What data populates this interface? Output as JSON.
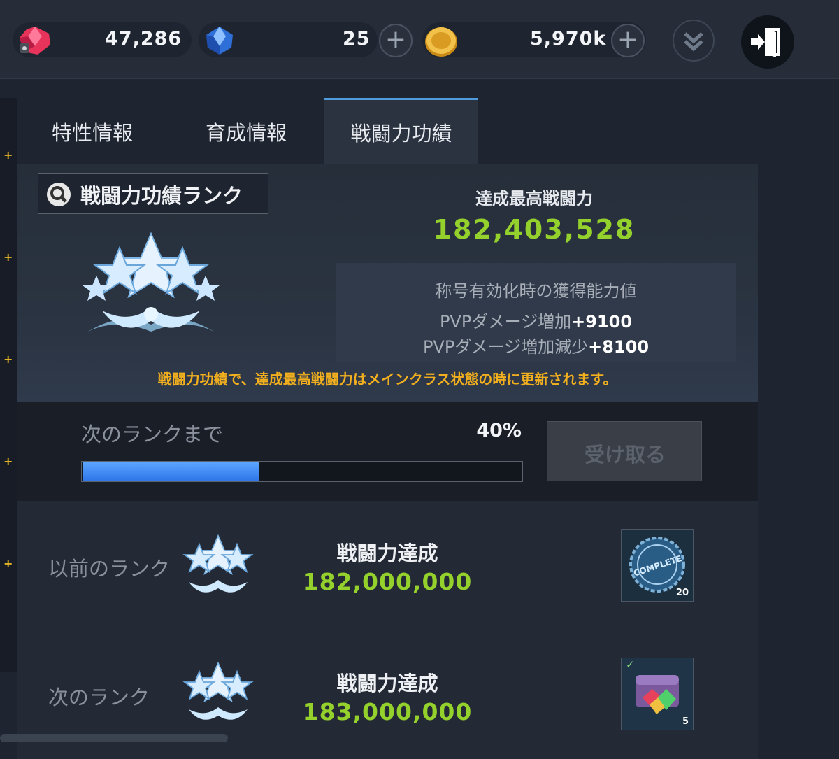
{
  "header": {
    "ruby": {
      "icon": "ruby-icon",
      "value": "47,286"
    },
    "sapphire": {
      "icon": "sapphire-icon",
      "value": "25"
    },
    "gold": {
      "icon": "gold-coin-icon",
      "value": "5,970k"
    },
    "plus_symbol": "+",
    "colors": {
      "ruby": "#e33a5a",
      "sapphire": "#3a7de0",
      "gold": "#e3a826"
    }
  },
  "tabs": [
    {
      "label": "特性情報",
      "active": false
    },
    {
      "label": "育成情報",
      "active": false
    },
    {
      "label": "戦闘力功績",
      "active": true
    }
  ],
  "rank_button": {
    "label": "戦闘力功績ランク",
    "icon": "search-icon"
  },
  "best": {
    "title": "達成最高戦闘力",
    "value": "182,403,528"
  },
  "title_box": {
    "heading": "称号有効化時の獲得能力値",
    "stats": [
      {
        "label": "PVPダメージ増加",
        "bonus": "+9100"
      },
      {
        "label": "PVPダメージ増加減少",
        "bonus": "+8100"
      }
    ]
  },
  "notice": "戦闘力功績で、達成最高戦闘力はメインクラス状態の時に更新されます。",
  "progress": {
    "label": "次のランクまで",
    "percent_text": "40%",
    "fraction": 0.4,
    "claim_label": "受け取る"
  },
  "ranks": [
    {
      "label": "以前のランク",
      "achieve_title": "戦闘力達成",
      "achieve_value": "182,000,000",
      "reward_icon": "complete-stamp-icon",
      "reward_text": "COMPLETE",
      "reward_count": "20"
    },
    {
      "label": "次のランク",
      "achieve_title": "戦闘力達成",
      "achieve_value": "183,000,000",
      "reward_icon": "treasure-chest-icon",
      "reward_check": "✓",
      "reward_count": "5"
    }
  ]
}
